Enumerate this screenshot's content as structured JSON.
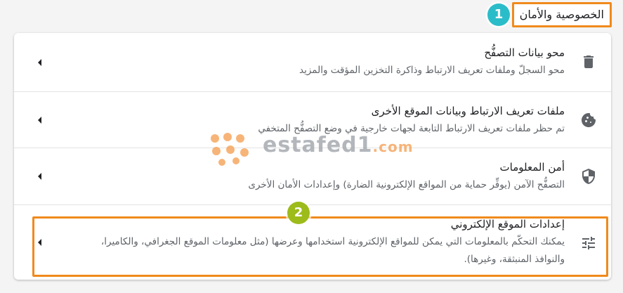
{
  "section": {
    "title": "الخصوصية والأمان"
  },
  "annotations": {
    "badge1": "1",
    "badge2": "2"
  },
  "watermark": {
    "main": "estafed1",
    "suffix": ".com"
  },
  "rows": [
    {
      "title": "محو بيانات التصفُّح",
      "desc": "محو السجلّ وملفات تعريف الارتباط وذاكرة التخزين المؤقت والمزيد",
      "icon": "trash-icon"
    },
    {
      "title": "ملفات تعريف الارتباط وبيانات الموقع الأخرى",
      "desc": "تم حظر ملفات تعريف الارتباط التابعة لجهات خارجية في وضع التصفُّح المتخفي",
      "icon": "cookie-icon"
    },
    {
      "title": "أمن المعلومات",
      "desc": "التصفُّح الآمن (يوفِّر حماية من المواقع الإلكترونية الضارة) وإعدادات الأمان الأخرى",
      "icon": "shield-icon"
    },
    {
      "title": "إعدادات الموقع الإلكتروني",
      "desc": "يمكنك التحكّم بالمعلومات التي يمكن للمواقع الإلكترونية استخدامها وعرضها (مثل معلومات الموقع الجغرافي، والكاميرا، والنوافذ المنبثقة، وغيرها).",
      "icon": "tune-icon"
    }
  ],
  "colors": {
    "highlight": "#f08a1c",
    "badge1": "#2bbcc9",
    "badge2": "#9dbb1b"
  }
}
